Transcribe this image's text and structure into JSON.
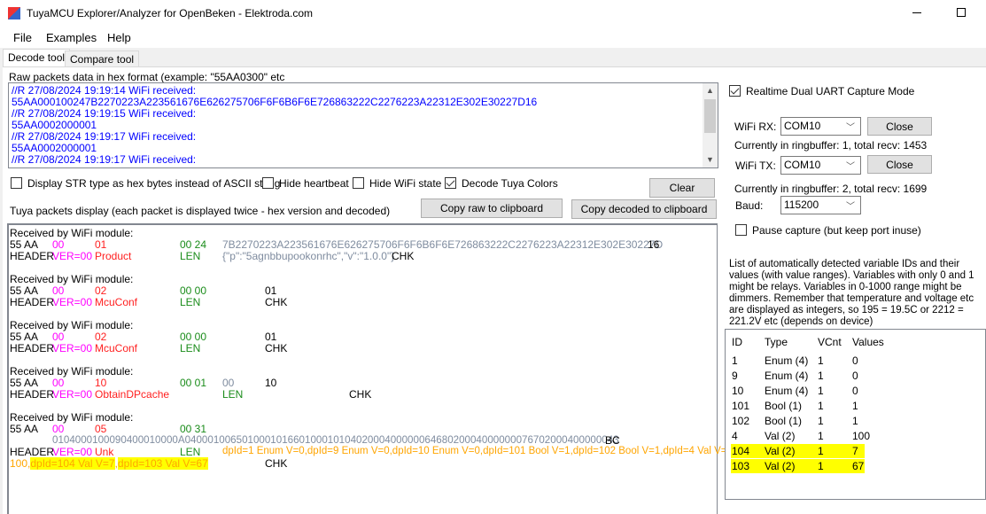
{
  "window": {
    "title": "TuyaMCU Explorer/Analyzer for OpenBeken - Elektroda.com"
  },
  "menu": [
    "File",
    "Examples",
    "Help"
  ],
  "tabs": [
    "Decode tool",
    "Compare tool"
  ],
  "raw": {
    "label": "Raw packets data in hex format (example: \"55AA0300\" etc",
    "lines": [
      "//R 27/08/2024 19:19:14 WiFi received:",
      "55AA000100247B2270223A223561676E626275706F6F6B6F6E726863222C2276223A22312E302E30227D16",
      "//R 27/08/2024 19:19:15 WiFi received:",
      "55AA0002000001",
      "//R 27/08/2024 19:19:17 WiFi received:",
      "55AA0002000001",
      "//R 27/08/2024 19:19:17 WiFi received:"
    ]
  },
  "options": {
    "str_hex": "Display STR type as hex bytes instead of ASCII string",
    "hide_heartbeat": "Hide heartbeat",
    "hide_wifi": "Hide WiFi state",
    "decode_colors": "Decode Tuya Colors",
    "clear": "Clear"
  },
  "display": {
    "label": "Tuya packets display (each packet is displayed twice - hex version and decoded)",
    "copy_raw": "Copy raw to clipboard",
    "copy_decoded": "Copy decoded to clipboard"
  },
  "packets": {
    "recv": "Received by WiFi module:",
    "hdr": "55 AA",
    "hdr_lbl": "HEADER",
    "ver": "00",
    "ver_lbl": "VER=00",
    "len_lbl": "LEN",
    "chk_lbl": "CHK",
    "p1": {
      "cmd": "01",
      "cmd_lbl": "Product",
      "len": "00 24",
      "data": "7B2270223A223561676E626275706F6F6B6F6E726863222C2276223A22312E302E30227D",
      "decoded": "{\"p\":\"5agnbbupookonrhc\",\"v\":\"1.0.0\"}",
      "chk": "16"
    },
    "p2": {
      "cmd": "02",
      "cmd_lbl": "McuConf",
      "len": "00 00",
      "chk": "01"
    },
    "p3": {
      "cmd": "02",
      "cmd_lbl": "McuConf",
      "len": "00 00",
      "chk": "01"
    },
    "p4": {
      "cmd": "10",
      "cmd_lbl": "ObtainDPcache",
      "len": "00 01",
      "data": "00",
      "chk": "10"
    },
    "p5": {
      "cmd": "05",
      "cmd_lbl": "Unk",
      "len": "00 31",
      "data": "0104000100090400010000A0400010065010001016601000101040200040000006468020004000000076702000400000043",
      "chk": "BC",
      "decoded1": "dpId=1 Enum V=0,dpId=9 Enum V=0,dpId=10 Enum V=0,dpId=101 Bool V=1,dpId=102 Bool V=1,dpId=4 Val V=",
      "decoded2a": "100,",
      "decoded2b": "dpId=104 Val V=7",
      ",": ",",
      "decoded2c": "dpId=103 Val V=67"
    }
  },
  "capture": {
    "realtime": "Realtime Dual UART Capture Mode",
    "rx_label": "WiFi RX:",
    "rx_port": "COM10",
    "close": "Close",
    "rx_status": "Currently in ringbuffer: 1, total recv: 1453",
    "tx_label": "WiFi TX:",
    "tx_port": "COM10",
    "tx_status": "Currently in ringbuffer: 2, total recv: 1699",
    "baud_label": "Baud:",
    "baud": "115200",
    "pause": "Pause capture (but keep port inuse)"
  },
  "vars": {
    "desc": "List of automatically detected variable IDs  and their values (with value ranges). Variables with only 0 and 1 might be relays. Variables in 0-1000 range might be dimmers. Remember that temperature and voltage etc are displayed as integers, so 195 = 19.5C or 2212 = 221.2V etc (depends on device)",
    "columns": [
      "ID",
      "Type",
      "VCnt",
      "Values"
    ],
    "rows": [
      [
        "1",
        "Enum (4)",
        "1",
        "0"
      ],
      [
        "9",
        "Enum (4)",
        "1",
        "0"
      ],
      [
        "10",
        "Enum (4)",
        "1",
        "0"
      ],
      [
        "101",
        "Bool (1)",
        "1",
        "1"
      ],
      [
        "102",
        "Bool (1)",
        "1",
        "1"
      ],
      [
        "4",
        "Val (2)",
        "1",
        "100"
      ],
      [
        "104",
        "Val (2)",
        "1",
        "7"
      ],
      [
        "103",
        "Val (2)",
        "1",
        "67"
      ]
    ]
  },
  "colors": {
    "highlight": "#ffff00",
    "raw_text": "#0000ff"
  }
}
